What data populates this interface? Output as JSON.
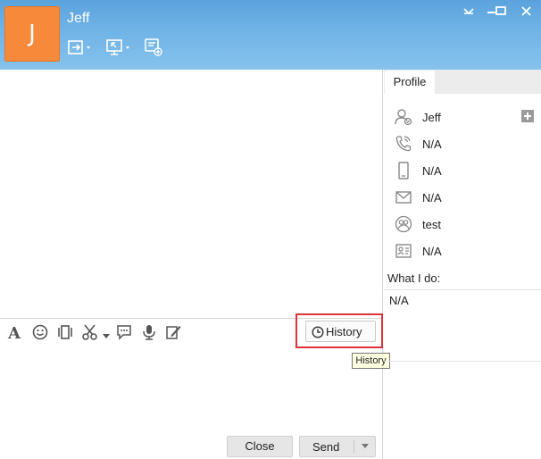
{
  "contact": {
    "initial": "J",
    "name": "Jeff"
  },
  "header_icons": [
    "send-file-icon",
    "screen-share-icon",
    "add-contact-chat-icon"
  ],
  "window_controls": [
    "pin-icon",
    "minimize-icon",
    "maximize-icon",
    "close-icon"
  ],
  "toolbar": {
    "icons": [
      "font-icon",
      "emoji-icon",
      "shake-icon",
      "screenshot-scissors-icon",
      "comment-icon",
      "microphone-icon",
      "edit-icon"
    ],
    "history_label": "History",
    "history_tooltip": "History"
  },
  "actions": {
    "close_label": "Close",
    "send_label": "Send"
  },
  "profile": {
    "tab_label": "Profile",
    "rows": [
      {
        "icon": "user-status-icon",
        "value": "Jeff"
      },
      {
        "icon": "phone-icon",
        "value": "N/A"
      },
      {
        "icon": "mobile-icon",
        "value": "N/A"
      },
      {
        "icon": "mail-icon",
        "value": "N/A"
      },
      {
        "icon": "group-icon",
        "value": "test"
      },
      {
        "icon": "id-card-icon",
        "value": "N/A"
      }
    ],
    "what_i_do_label": "What I do:",
    "what_i_do_value": "N/A"
  },
  "colors": {
    "header": "#6eb2e6",
    "avatar": "#f7893a",
    "highlight": "#e0303a",
    "tooltip_bg": "#ffffe1"
  }
}
